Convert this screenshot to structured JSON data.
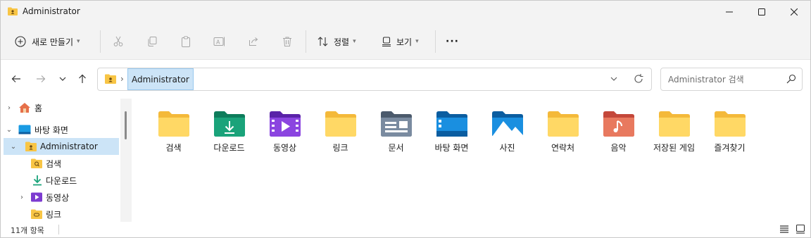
{
  "window": {
    "title": "Administrator"
  },
  "toolbar": {
    "new_label": "새로 만들기",
    "sort_label": "정렬",
    "view_label": "보기",
    "more_label": "···"
  },
  "address": {
    "crumb": "Administrator"
  },
  "search": {
    "placeholder": "Administrator 검색"
  },
  "sidebar": {
    "items": [
      {
        "label": "홈",
        "icon": "home-icon",
        "expandable": true,
        "expanded": false
      },
      {
        "label": "바탕 화면",
        "icon": "desktop-icon",
        "expandable": true,
        "expanded": true
      },
      {
        "label": "Administrator",
        "icon": "user-folder-icon",
        "expandable": true,
        "expanded": true,
        "selected": true
      },
      {
        "label": "검색",
        "icon": "search-folder-icon",
        "expandable": false
      },
      {
        "label": "다운로드",
        "icon": "download-icon",
        "expandable": false
      },
      {
        "label": "동영상",
        "icon": "videos-icon",
        "expandable": true,
        "expanded": false
      },
      {
        "label": "링크",
        "icon": "links-folder-icon",
        "expandable": false
      }
    ]
  },
  "folders": [
    {
      "label": "검색",
      "icon": "search-folder-icon"
    },
    {
      "label": "다운로드",
      "icon": "downloads-folder-icon"
    },
    {
      "label": "동영상",
      "icon": "videos-folder-icon"
    },
    {
      "label": "링크",
      "icon": "links-folder-icon"
    },
    {
      "label": "문서",
      "icon": "documents-folder-icon"
    },
    {
      "label": "바탕 화면",
      "icon": "desktop-folder-icon"
    },
    {
      "label": "사진",
      "icon": "pictures-folder-icon"
    },
    {
      "label": "연락처",
      "icon": "contacts-folder-icon"
    },
    {
      "label": "음악",
      "icon": "music-folder-icon"
    },
    {
      "label": "저장된 게임",
      "icon": "saved-games-folder-icon"
    },
    {
      "label": "즐겨찾기",
      "icon": "favorites-folder-icon"
    }
  ],
  "status": {
    "count": "11개 항목"
  },
  "colors": {
    "folder_yellow": "#f8c545",
    "folder_yellow_light": "#ffd865",
    "selection": "#cce4f7",
    "accent": "#0067c0"
  }
}
